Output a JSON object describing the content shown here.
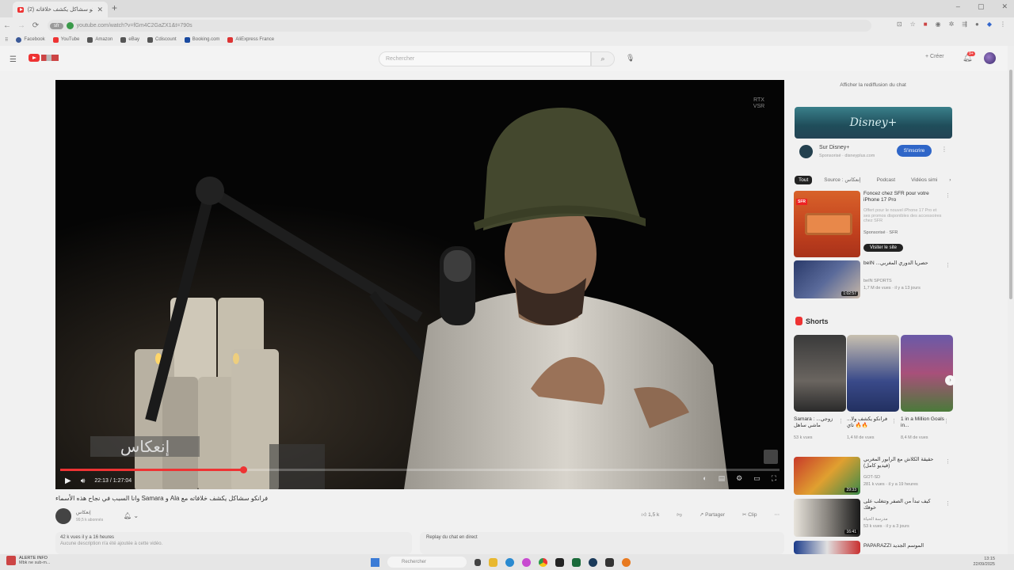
{
  "browser": {
    "tab_title": "(2) فرانكو سشاكل يكشف خلافاته",
    "new_tab": "+",
    "window_buttons": [
      "–",
      "▢",
      "✕"
    ],
    "sfr_label": "sfr",
    "url": "youtube.com/watch?v=fGm4C2GaZX1&t=790s",
    "bookmarks": [
      {
        "label": "Facebook",
        "color": "#3b5998"
      },
      {
        "label": "YouTube",
        "color": "#e33"
      },
      {
        "label": "Amazon",
        "color": "#555"
      },
      {
        "label": "eBay",
        "color": "#555"
      },
      {
        "label": "Cdiscount",
        "color": "#555"
      },
      {
        "label": "Booking.com",
        "color": "#1a4aa0"
      },
      {
        "label": "AliExpress France",
        "color": "#d33"
      }
    ]
  },
  "youtube": {
    "search_placeholder": "Rechercher",
    "create_label": "Créer",
    "notification_count": "9+"
  },
  "video": {
    "watermark": "RTX VSR",
    "caption": "إنعكاس",
    "time_current": "22:13",
    "time_total": "1:27:04",
    "progress": 0.2548,
    "title": "وانا السبب في نجاح هذه الأسماء Samara و Ala فرانكو سشاكل يكشف خلافاته مع",
    "channel_name": "إنعكاس",
    "channel_subs": "99,5 k abonnés",
    "likes": "1,5 k",
    "share": "Partager",
    "clip": "Clip",
    "views_line": "42 k vues  il y a 16 heures",
    "description": "Aucune description n'a été ajoutée à cette vidéo.",
    "chat_replay": "Replay du chat en direct"
  },
  "sidebar": {
    "show_chat": "Afficher la rediffusion du chat",
    "disney_banner": "Disney+",
    "disney_title": "Sur Disney+",
    "disney_sub": "Sponsorisé · disneyplus.com",
    "subscribe": "S'inscrire",
    "chips": [
      {
        "label": "Tout",
        "active": true
      },
      {
        "label": "Source : إنعكاس",
        "active": false
      },
      {
        "label": "Podcast",
        "active": false
      },
      {
        "label": "Vidéos simi",
        "active": false
      }
    ],
    "recs": [
      {
        "title": "Foncez chez SFR pour votre iPhone 17 Pro",
        "sub": "Offert pour le nouvel iPhone 17 Pro et ses promos disponibles des accessoires chez SFR",
        "meta": "Sponsorisé · SFR",
        "visit": "Visiter le site"
      },
      {
        "title": "beIN ...حصريا الدوري المغربي",
        "channel": "beIN SPORTS",
        "meta": "1,7 M de vues · il y a 13 jours",
        "duration": "1:02:57"
      }
    ],
    "shorts_title": "Shorts",
    "shorts": [
      {
        "title": "Samara : زوجي... ماشي ساهل",
        "views": "53 k vues"
      },
      {
        "title": "فرانكو يكشف ولا... تاي 🔥🔥",
        "views": "1,4 M de vues"
      },
      {
        "title": "1 in a Million Goals in...",
        "views": "8,4 M de vues"
      }
    ],
    "recs2": [
      {
        "title": "حقيقة الكلاش مع الرابور المغربي (فيديو كامل)",
        "channel": "GOT-SD",
        "meta": "281 k vues · il y a 19 heures",
        "duration": "29:33"
      },
      {
        "title": "كيف تبدأ من الصفر وتتغلب على خوفك",
        "channel": "مدرسة الحياة",
        "meta": "53 k vues · il y a 3 jours",
        "duration": "16:41"
      },
      {
        "title": "PAPARAZZI الموسم الجديد",
        "channel": "",
        "meta": "",
        "duration": ""
      }
    ]
  },
  "taskbar": {
    "alert_title": "ALERTE INFO",
    "alert_sub": "Mbk ne sub-m...",
    "search": "Rechercher",
    "time": "13:15",
    "date": "22/09/2025"
  },
  "colors": {
    "accent_red": "#e33",
    "subscribe_blue": "#2f66c8"
  }
}
